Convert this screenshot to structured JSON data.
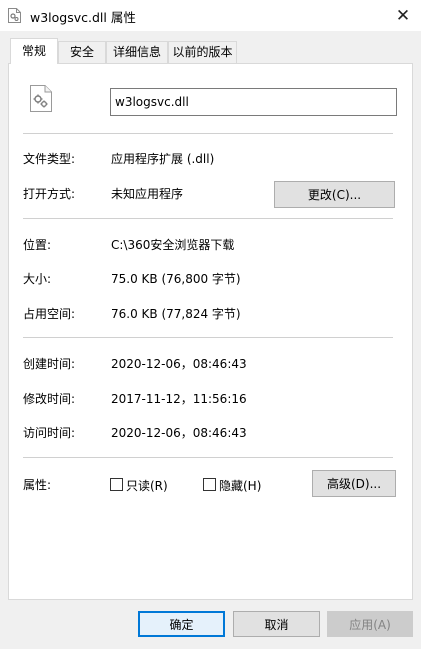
{
  "window": {
    "title": "w3logsvc.dll 属性",
    "close_glyph": "✕"
  },
  "tabs": [
    {
      "label": "常规",
      "active": true
    },
    {
      "label": "安全",
      "active": false
    },
    {
      "label": "详细信息",
      "active": false
    },
    {
      "label": "以前的版本",
      "active": false
    }
  ],
  "general": {
    "file_name": "w3logsvc.dll",
    "type_label": "文件类型:",
    "type_value": "应用程序扩展 (.dll)",
    "opens_with_label": "打开方式:",
    "opens_with_value": "未知应用程序",
    "change_button": "更改(C)...",
    "location_label": "位置:",
    "location_value": "C:\\360安全浏览器下载",
    "size_label": "大小:",
    "size_value": "75.0 KB (76,800 字节)",
    "size_on_disk_label": "占用空间:",
    "size_on_disk_value": "76.0 KB (77,824 字节)",
    "created_label": "创建时间:",
    "created_value": "2020-12-06，08:46:43",
    "modified_label": "修改时间:",
    "modified_value": "2017-11-12，11:56:16",
    "accessed_label": "访问时间:",
    "accessed_value": "2020-12-06，08:46:43",
    "attributes_label": "属性:",
    "readonly_label": "只读(R)",
    "readonly_checked": false,
    "hidden_label": "隐藏(H)",
    "hidden_checked": false,
    "advanced_button": "高级(D)..."
  },
  "footer": {
    "ok_button": "确定",
    "cancel_button": "取消",
    "apply_button": "应用(A)"
  },
  "colors": {
    "accent": "#0078d7",
    "window_bg": "#f0f0f0",
    "panel_bg": "#ffffff"
  }
}
